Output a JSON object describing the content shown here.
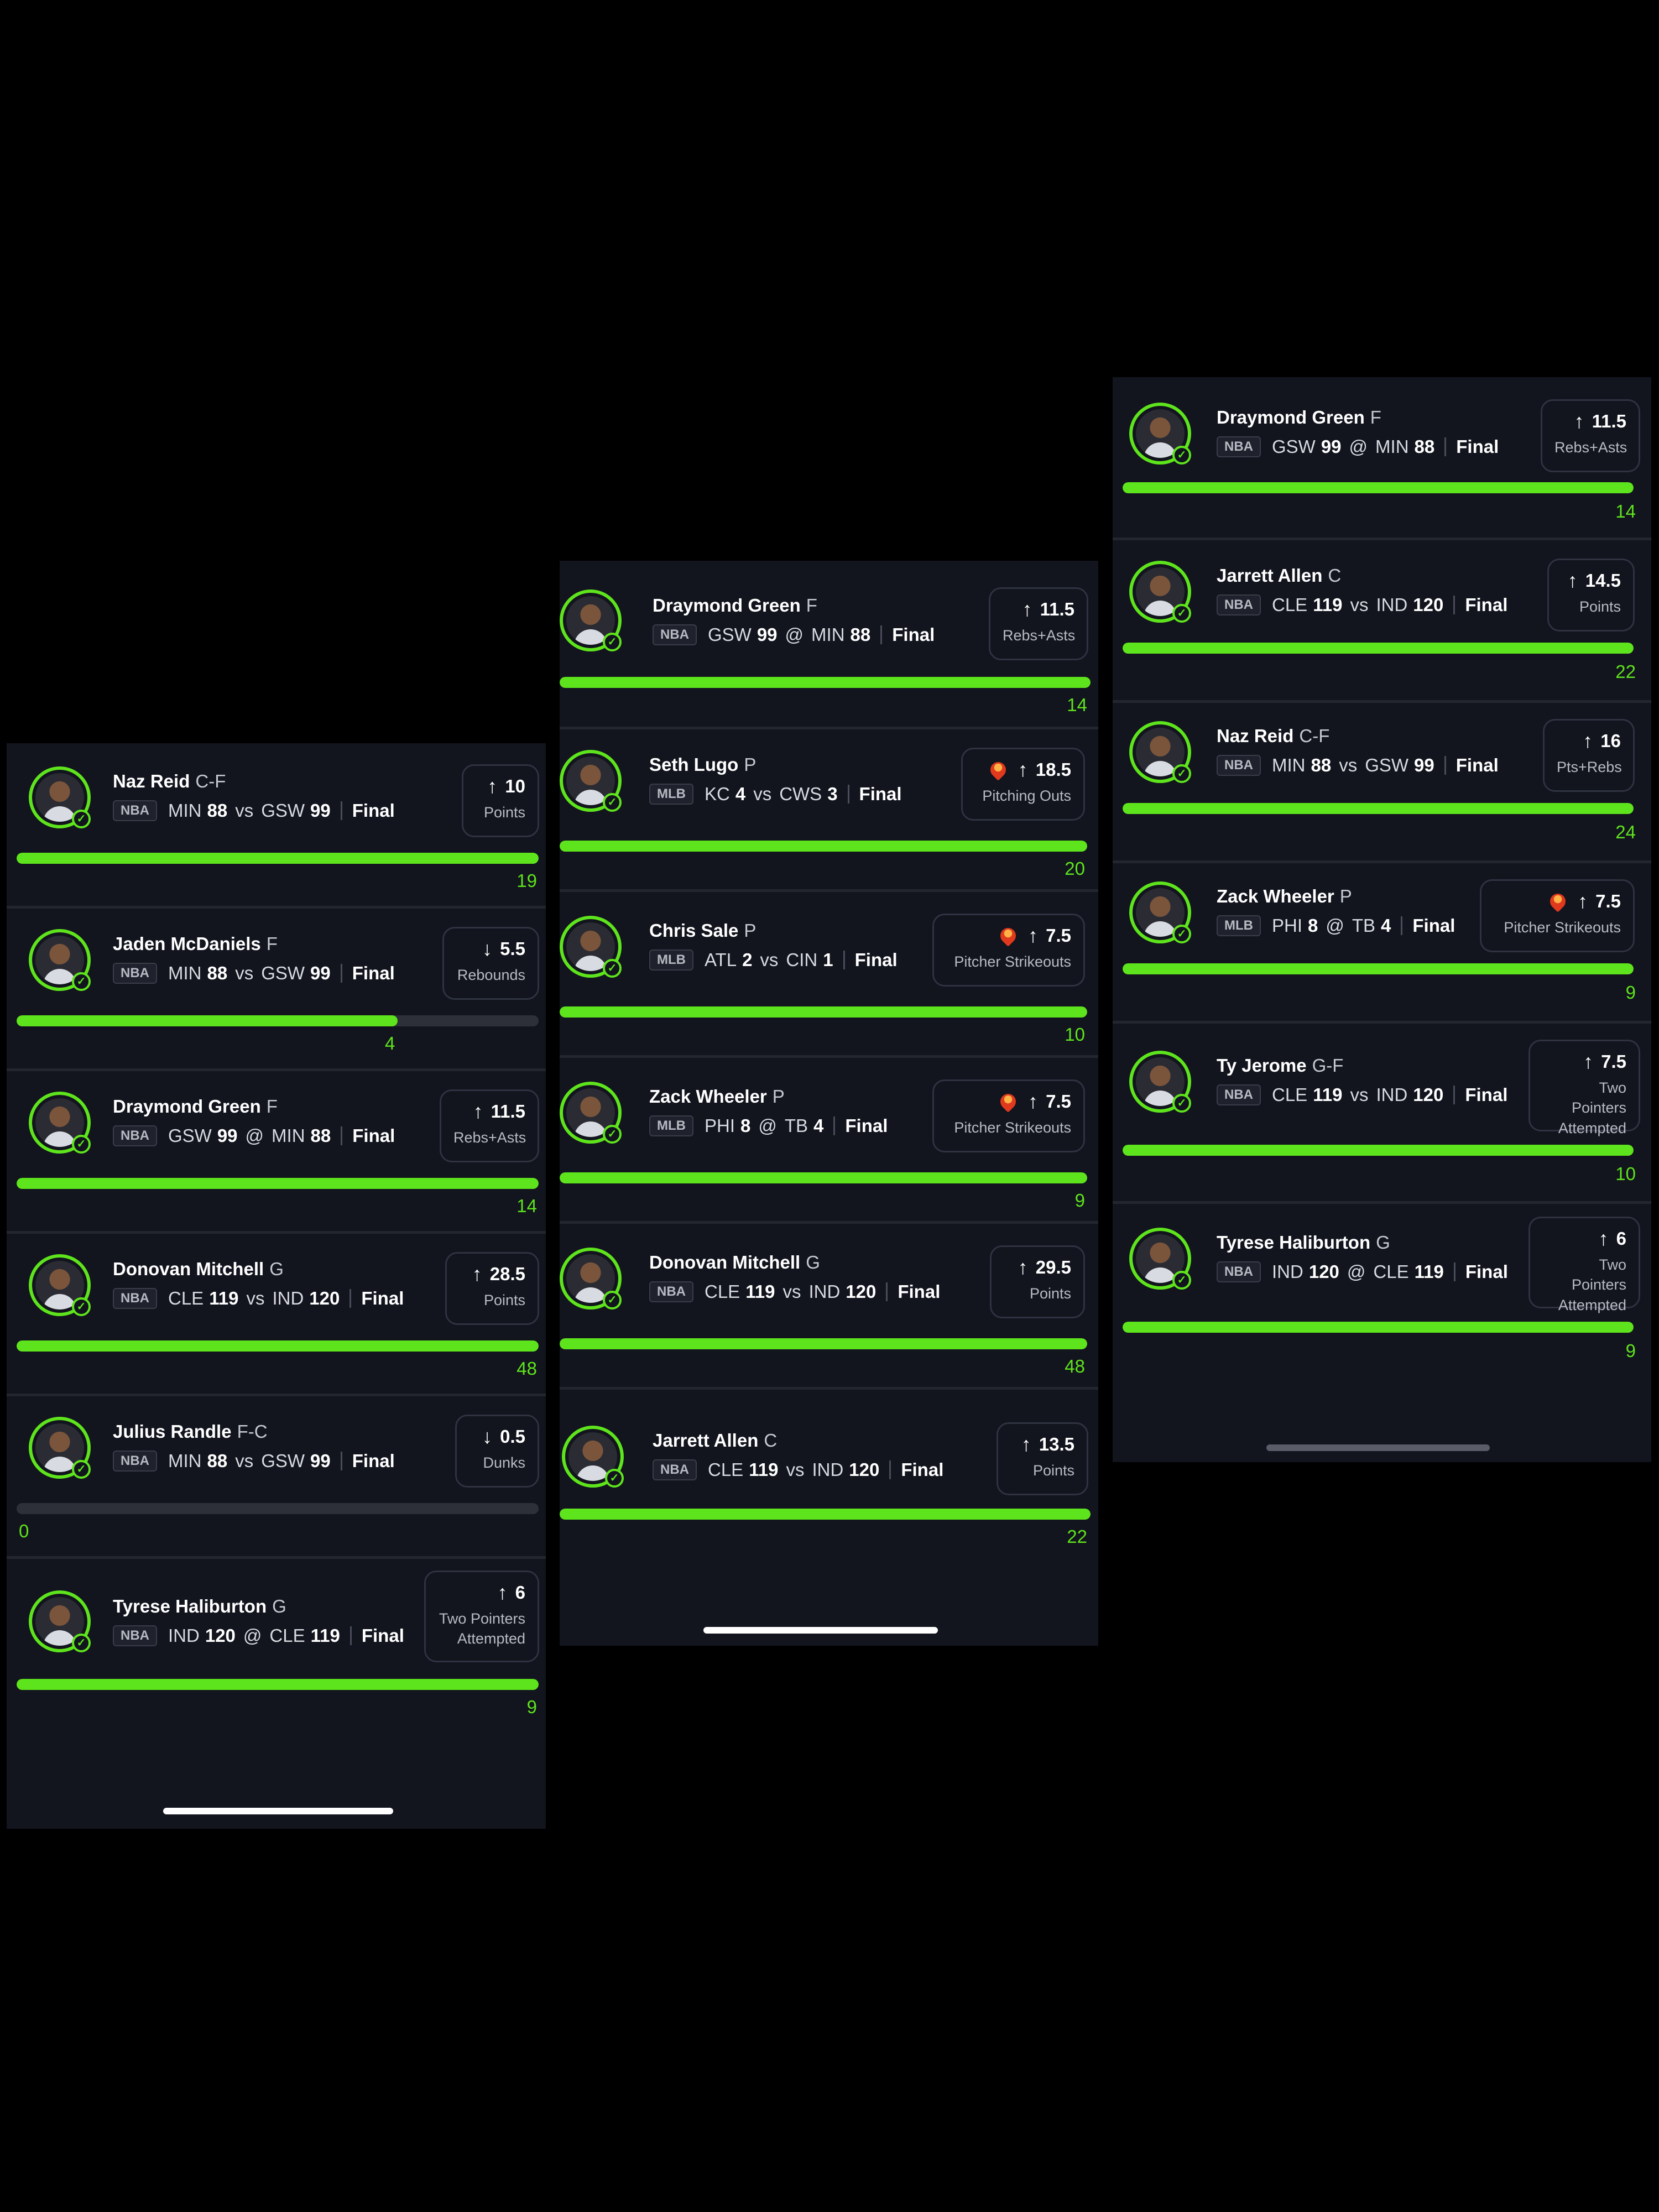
{
  "panels": [
    {
      "picks": [
        {
          "name": "Naz Reid",
          "pos": "C-F",
          "league": "NBA",
          "team1": "MIN",
          "score1": "88",
          "sep": "vs",
          "team2": "GSW",
          "score2": "99",
          "status": "Final",
          "dir": "up",
          "line": "10",
          "stat": "Points",
          "actual": "19",
          "progress": 1.0,
          "flame": false
        },
        {
          "name": "Jaden McDaniels",
          "pos": "F",
          "league": "NBA",
          "team1": "MIN",
          "score1": "88",
          "sep": "vs",
          "team2": "GSW",
          "score2": "99",
          "status": "Final",
          "dir": "down",
          "line": "5.5",
          "stat": "Rebounds",
          "actual": "4",
          "progress": 0.73,
          "flame": false
        },
        {
          "name": "Draymond Green",
          "pos": "F",
          "league": "NBA",
          "team1": "GSW",
          "score1": "99",
          "sep": "@",
          "team2": "MIN",
          "score2": "88",
          "status": "Final",
          "dir": "up",
          "line": "11.5",
          "stat": "Rebs+Asts",
          "actual": "14",
          "progress": 1.0,
          "flame": false
        },
        {
          "name": "Donovan Mitchell",
          "pos": "G",
          "league": "NBA",
          "team1": "CLE",
          "score1": "119",
          "sep": "vs",
          "team2": "IND",
          "score2": "120",
          "status": "Final",
          "dir": "up",
          "line": "28.5",
          "stat": "Points",
          "actual": "48",
          "progress": 1.0,
          "flame": false
        },
        {
          "name": "Julius Randle",
          "pos": "F-C",
          "league": "NBA",
          "team1": "MIN",
          "score1": "88",
          "sep": "vs",
          "team2": "GSW",
          "score2": "99",
          "status": "Final",
          "dir": "down",
          "line": "0.5",
          "stat": "Dunks",
          "actual": "0",
          "progress": 0.0,
          "flame": false
        },
        {
          "name": "Tyrese Haliburton",
          "pos": "G",
          "league": "NBA",
          "team1": "IND",
          "score1": "120",
          "sep": "@",
          "team2": "CLE",
          "score2": "119",
          "status": "Final",
          "dir": "up",
          "line": "6",
          "stat": "Two Pointers Attempted",
          "actual": "9",
          "progress": 1.0,
          "flame": false
        }
      ]
    },
    {
      "picks": [
        {
          "name": "Draymond Green",
          "pos": "F",
          "league": "NBA",
          "team1": "GSW",
          "score1": "99",
          "sep": "@",
          "team2": "MIN",
          "score2": "88",
          "status": "Final",
          "dir": "up",
          "line": "11.5",
          "stat": "Rebs+Asts",
          "actual": "14",
          "progress": 1.0,
          "flame": false
        },
        {
          "name": "Seth Lugo",
          "pos": "P",
          "league": "MLB",
          "team1": "KC",
          "score1": "4",
          "sep": "vs",
          "team2": "CWS",
          "score2": "3",
          "status": "Final",
          "dir": "up",
          "line": "18.5",
          "stat": "Pitching Outs",
          "actual": "20",
          "progress": 1.0,
          "flame": true
        },
        {
          "name": "Chris Sale",
          "pos": "P",
          "league": "MLB",
          "team1": "ATL",
          "score1": "2",
          "sep": "vs",
          "team2": "CIN",
          "score2": "1",
          "status": "Final",
          "dir": "up",
          "line": "7.5",
          "stat": "Pitcher Strikeouts",
          "actual": "10",
          "progress": 1.0,
          "flame": true
        },
        {
          "name": "Zack Wheeler",
          "pos": "P",
          "league": "MLB",
          "team1": "PHI",
          "score1": "8",
          "sep": "@",
          "team2": "TB",
          "score2": "4",
          "status": "Final",
          "dir": "up",
          "line": "7.5",
          "stat": "Pitcher Strikeouts",
          "actual": "9",
          "progress": 1.0,
          "flame": true
        },
        {
          "name": "Donovan Mitchell",
          "pos": "G",
          "league": "NBA",
          "team1": "CLE",
          "score1": "119",
          "sep": "vs",
          "team2": "IND",
          "score2": "120",
          "status": "Final",
          "dir": "up",
          "line": "29.5",
          "stat": "Points",
          "actual": "48",
          "progress": 1.0,
          "flame": false
        },
        {
          "name": "Jarrett Allen",
          "pos": "C",
          "league": "NBA",
          "team1": "CLE",
          "score1": "119",
          "sep": "vs",
          "team2": "IND",
          "score2": "120",
          "status": "Final",
          "dir": "up",
          "line": "13.5",
          "stat": "Points",
          "actual": "22",
          "progress": 1.0,
          "flame": false
        }
      ]
    },
    {
      "picks": [
        {
          "name": "Draymond Green",
          "pos": "F",
          "league": "NBA",
          "team1": "GSW",
          "score1": "99",
          "sep": "@",
          "team2": "MIN",
          "score2": "88",
          "status": "Final",
          "dir": "up",
          "line": "11.5",
          "stat": "Rebs+Asts",
          "actual": "14",
          "progress": 1.0,
          "flame": false
        },
        {
          "name": "Jarrett Allen",
          "pos": "C",
          "league": "NBA",
          "team1": "CLE",
          "score1": "119",
          "sep": "vs",
          "team2": "IND",
          "score2": "120",
          "status": "Final",
          "dir": "up",
          "line": "14.5",
          "stat": "Points",
          "actual": "22",
          "progress": 1.0,
          "flame": false
        },
        {
          "name": "Naz Reid",
          "pos": "C-F",
          "league": "NBA",
          "team1": "MIN",
          "score1": "88",
          "sep": "vs",
          "team2": "GSW",
          "score2": "99",
          "status": "Final",
          "dir": "up",
          "line": "16",
          "stat": "Pts+Rebs",
          "actual": "24",
          "progress": 1.0,
          "flame": false
        },
        {
          "name": "Zack Wheeler",
          "pos": "P",
          "league": "MLB",
          "team1": "PHI",
          "score1": "8",
          "sep": "@",
          "team2": "TB",
          "score2": "4",
          "status": "Final",
          "dir": "up",
          "line": "7.5",
          "stat": "Pitcher Strikeouts",
          "actual": "9",
          "progress": 1.0,
          "flame": true
        },
        {
          "name": "Ty Jerome",
          "pos": "G-F",
          "league": "NBA",
          "team1": "CLE",
          "score1": "119",
          "sep": "vs",
          "team2": "IND",
          "score2": "120",
          "status": "Final",
          "dir": "up",
          "line": "7.5",
          "stat": "Two Pointers Attempted",
          "actual": "10",
          "progress": 1.0,
          "flame": false
        },
        {
          "name": "Tyrese Haliburton",
          "pos": "G",
          "league": "NBA",
          "team1": "IND",
          "score1": "120",
          "sep": "@",
          "team2": "CLE",
          "score2": "119",
          "status": "Final",
          "dir": "up",
          "line": "6",
          "stat": "Two Pointers Attempted",
          "actual": "9",
          "progress": 1.0,
          "flame": false
        }
      ]
    }
  ],
  "colors": {
    "accent": "#5ee41c",
    "background": "#12141e",
    "track": "#2d3039"
  },
  "icons": {
    "up": "arrow-up-icon",
    "down": "arrow-down-icon",
    "check": "check-icon",
    "flame": "flame-icon"
  }
}
